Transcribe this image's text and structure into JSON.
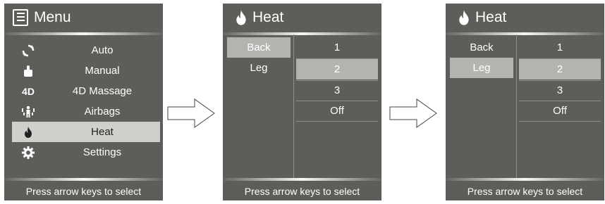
{
  "menu_screen": {
    "title": "Menu",
    "items": [
      {
        "label": "Auto",
        "icon": "refresh-icon"
      },
      {
        "label": "Manual",
        "icon": "hand-icon"
      },
      {
        "label": "4D Massage",
        "icon": "4d-icon",
        "icon_text": "4D"
      },
      {
        "label": "Airbags",
        "icon": "airbag-person-icon"
      },
      {
        "label": "Heat",
        "icon": "flame-icon"
      },
      {
        "label": "Settings",
        "icon": "gear-icon"
      }
    ],
    "selected": "Heat",
    "footer": "Press arrow keys to select"
  },
  "heat_screen_1": {
    "title": "Heat",
    "zones": [
      "Back",
      "Leg"
    ],
    "levels": [
      "1",
      "2",
      "3",
      "Off"
    ],
    "selected_zone": "Back",
    "selected_level": "2",
    "footer": "Press arrow keys to select"
  },
  "heat_screen_2": {
    "title": "Heat",
    "zones": [
      "Back",
      "Leg"
    ],
    "levels": [
      "1",
      "2",
      "3",
      "Off"
    ],
    "selected_zone": "Leg",
    "selected_level": "2",
    "footer": "Press arrow keys to select"
  },
  "colors": {
    "screen_bg": "#5e5d59",
    "menu_highlight": "#d0cfcb",
    "cell_highlight": "#b4b3af",
    "text": "#ffffff"
  }
}
